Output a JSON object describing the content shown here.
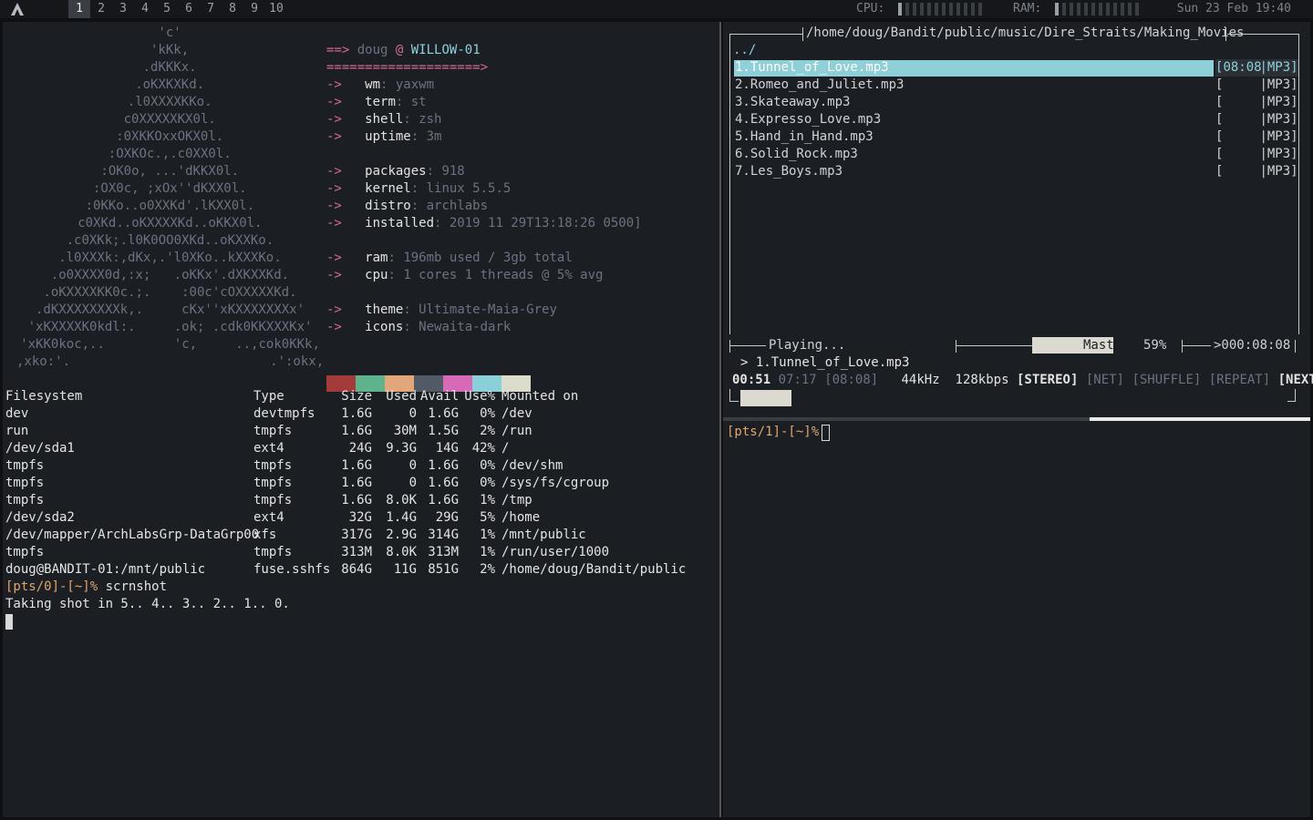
{
  "topbar": {
    "workspaces": [
      "1",
      "2",
      "3",
      "4",
      "5",
      "6",
      "7",
      "8",
      "9",
      "10"
    ],
    "active_workspace": "1",
    "cpu_label": "CPU:",
    "ram_label": "RAM:",
    "cpu_usage": 0.05,
    "ram_usage": 0.07,
    "clock": "Sun 23 Feb 19:40"
  },
  "colors": {
    "accent": "#8fcfd8",
    "prompt": "#e0a66b",
    "ascii_red": "#c65656"
  },
  "neofetch": {
    "ascii": [
      "'c'",
      "'kKk,",
      ".dKKKx.",
      ".oKXKXKd.",
      ".l0XXXXKKo.",
      "c0XXXXXKX0l.",
      ":0XKKOxxOKX0l.",
      ":OXKOc.,.c0XX0l.",
      ":OK0o, ...'dKKX0l.",
      ":OX0c, ;xOx''dKXX0l.",
      ":0KKo..o0XXKd'.lKXX0l.",
      "c0XKd..oKXXXXKd..oKKX0l.",
      ".c0XKk;.l0K0OO0XKd..oKXXKo.",
      ".l0XXXk:,dKx,.'l0XKo..kXXXKo.",
      ".o0XXXX0d,:x;   .oKKx'.dXKXXKd.",
      ".oKXXXXKK0c.;.    :00c'cOXXXXXKd.",
      ".dKXXXXXXXXk,.     cKx''xKXXXXXXXx'",
      "'xKXXXXK0kdl:.     .ok; .cdk0KKXXXKx'",
      "'xKK0koc,..         'c,     ..,cok0KKk,",
      ",xko:'.                          .':okx,"
    ],
    "header_arrow": "==>",
    "user": "doug",
    "at": "@",
    "host": "WILLOW-01",
    "underline": "====================>",
    "arrow": "->",
    "info": [
      {
        "key": "wm",
        "value": "yaxwm"
      },
      {
        "key": "term",
        "value": "st"
      },
      {
        "key": "shell",
        "value": "zsh"
      },
      {
        "key": "uptime",
        "value": "3m"
      },
      {
        "key": "packages",
        "value": "918"
      },
      {
        "key": "kernel",
        "value": "linux 5.5.5"
      },
      {
        "key": "distro",
        "value": "archlabs"
      },
      {
        "key": "installed",
        "value": "2019 11 29T13:18:26 0500]"
      },
      {
        "key": "ram",
        "value": "196mb used / 3gb total"
      },
      {
        "key": "cpu",
        "value": "1 cores 1 threads @ 5% avg"
      },
      {
        "key": "theme",
        "value": "Ultimate-Maia-Grey"
      },
      {
        "key": "icons",
        "value": "Newaita-dark"
      }
    ],
    "palette": [
      "#a33b3b",
      "#5fb38c",
      "#e3a57a",
      "#525a66",
      "#d769b9",
      "#8bcfd8",
      "#dcdccc"
    ]
  },
  "df": {
    "headers": [
      "Filesystem",
      "Type",
      "Size",
      "Used",
      "Avail",
      "Use%",
      "Mounted on"
    ],
    "rows": [
      [
        "dev",
        "devtmpfs",
        "1.6G",
        "0",
        "1.6G",
        "0%",
        "/dev"
      ],
      [
        "run",
        "tmpfs",
        "1.6G",
        "30M",
        "1.5G",
        "2%",
        "/run"
      ],
      [
        "/dev/sda1",
        "ext4",
        "24G",
        "9.3G",
        "14G",
        "42%",
        "/"
      ],
      [
        "tmpfs",
        "tmpfs",
        "1.6G",
        "0",
        "1.6G",
        "0%",
        "/dev/shm"
      ],
      [
        "tmpfs",
        "tmpfs",
        "1.6G",
        "0",
        "1.6G",
        "0%",
        "/sys/fs/cgroup"
      ],
      [
        "tmpfs",
        "tmpfs",
        "1.6G",
        "8.0K",
        "1.6G",
        "1%",
        "/tmp"
      ],
      [
        "/dev/sda2",
        "ext4",
        "32G",
        "1.4G",
        "29G",
        "5%",
        "/home"
      ],
      [
        "/dev/mapper/ArchLabsGrp-DataGrp00",
        "xfs",
        "317G",
        "2.9G",
        "314G",
        "1%",
        "/mnt/public"
      ],
      [
        "tmpfs",
        "tmpfs",
        "313M",
        "8.0K",
        "313M",
        "1%",
        "/run/user/1000"
      ],
      [
        "doug@BANDIT-01:/mnt/public",
        "fuse.sshfs",
        "864G",
        "11G",
        "851G",
        "2%",
        "/home/doug/Bandit/public"
      ]
    ]
  },
  "shell1": {
    "prompt": "[pts/0]-[~]%",
    "command": "scrnshot",
    "output": "Taking shot in 5.. 4.. 3.. 2.. 1.. 0."
  },
  "ncmpcpp": {
    "path": "/home/doug/Bandit/public/music/Dire_Straits/Making_Movies",
    "parent": "../",
    "tracks": [
      {
        "name": "1.Tunnel_of_Love.mp3",
        "time": "08:08",
        "fmt": "MP3"
      },
      {
        "name": "2.Romeo_and_Juliet.mp3",
        "time": "",
        "fmt": "MP3"
      },
      {
        "name": "3.Skateaway.mp3",
        "time": "",
        "fmt": "MP3"
      },
      {
        "name": "4.Expresso_Love.mp3",
        "time": "",
        "fmt": "MP3"
      },
      {
        "name": "5.Hand_in_Hand.mp3",
        "time": "",
        "fmt": "MP3"
      },
      {
        "name": "6.Solid_Rock.mp3",
        "time": "",
        "fmt": "MP3"
      },
      {
        "name": "7.Les_Boys.mp3",
        "time": "",
        "fmt": "MP3"
      }
    ],
    "status": "Playing...",
    "volume_label": "Master",
    "volume_pct": "59%",
    "volume": 0.59,
    "total_time": ">000:08:08",
    "now_playing": "> 1.Tunnel_of_Love.mp3",
    "elapsed": "00:51",
    "remaining": "07:17",
    "total": "[08:08]",
    "rate": "44kHz",
    "bitrate": "128kbps",
    "stereo": "[STEREO]",
    "net": "[NET]",
    "shuffle": "[SHUFFLE]",
    "repeat": "[REPEAT]",
    "next": "[NEXT]",
    "progress": 0.1
  },
  "shell2": {
    "prompt": "[pts/1]-[~]%"
  }
}
